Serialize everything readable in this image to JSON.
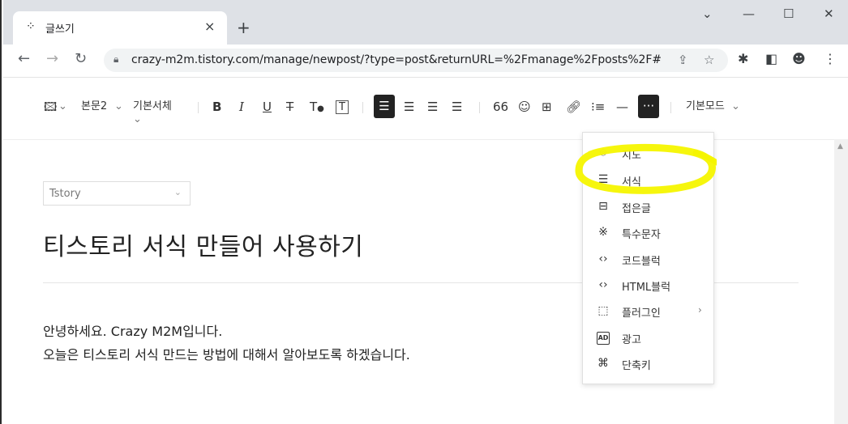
{
  "browser": {
    "tab_title": "글쓰기",
    "tab_close": "×",
    "new_tab": "+",
    "window_controls": [
      "⌄",
      "—",
      "☐",
      "✕"
    ],
    "url": "crazy-m2m.tistory.com/manage/newpost/?type=post&returnURL=%2Fmanage%2Fposts%2F#"
  },
  "toolbar": {
    "paragraph_style": "본문2",
    "font": "기본서체",
    "mode": "기본모드",
    "quote_label": "66"
  },
  "editor": {
    "category": "Tstory",
    "title": "티스토리 서식 만들어 사용하기",
    "body_line_1": "안녕하세요. Crazy M2M입니다.",
    "body_line_2": "오늘은 티스토리 서식 만드는 방법에 대해서 알아보도록 하겠습니다."
  },
  "menu": {
    "items": [
      {
        "label": "지도",
        "icon": "map-pin-icon"
      },
      {
        "label": "서식",
        "icon": "template-icon"
      },
      {
        "label": "접은글",
        "icon": "fold-icon"
      },
      {
        "label": "특수문자",
        "icon": "special-char-icon"
      },
      {
        "label": "코드블럭",
        "icon": "code-icon"
      },
      {
        "label": "HTML블럭",
        "icon": "html-icon"
      },
      {
        "label": "플러그인",
        "icon": "plugin-icon"
      },
      {
        "label": "광고",
        "icon": "ad-icon",
        "icon_text": "AD"
      },
      {
        "label": "단축키",
        "icon": "shortcut-icon"
      }
    ]
  },
  "colors": {
    "highlight": "#f5f500",
    "active_tool_bg": "#222222",
    "tab_strip": "#dee1e6"
  }
}
